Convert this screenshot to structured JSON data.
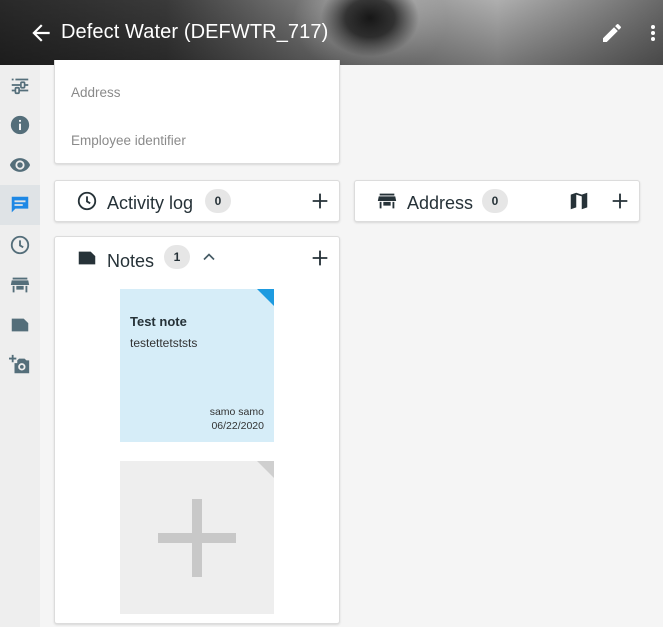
{
  "header": {
    "title": "Defect Water (DEFWTR_717)",
    "back_icon": "arrow-back-icon",
    "edit_icon": "pencil-icon",
    "more_icon": "more-vertical-icon"
  },
  "sidebar": {
    "items": [
      {
        "name": "properties",
        "icon": "tune-icon"
      },
      {
        "name": "info",
        "icon": "info-icon"
      },
      {
        "name": "watch",
        "icon": "eye-icon"
      },
      {
        "name": "notes",
        "icon": "comment-icon",
        "active": true
      },
      {
        "name": "activity-log",
        "icon": "clock-icon"
      },
      {
        "name": "address",
        "icon": "store-icon"
      },
      {
        "name": "labels",
        "icon": "label-icon"
      },
      {
        "name": "add-photo",
        "icon": "camera-plus-icon"
      }
    ]
  },
  "details": {
    "address_label": "Address",
    "employee_label": "Employee identifier"
  },
  "activity_log": {
    "title": "Activity log",
    "count": "0"
  },
  "address_panel": {
    "title": "Address",
    "count": "0"
  },
  "notes": {
    "title": "Notes",
    "count": "1",
    "items": [
      {
        "title": "Test note",
        "body": "testettetststs",
        "author": "samo samo",
        "date": "06/22/2020"
      }
    ]
  },
  "colors": {
    "accent": "#1e9be0",
    "note_bg": "#d6edf8",
    "icon": "#263238",
    "sidebar_icon": "#546e7a"
  }
}
